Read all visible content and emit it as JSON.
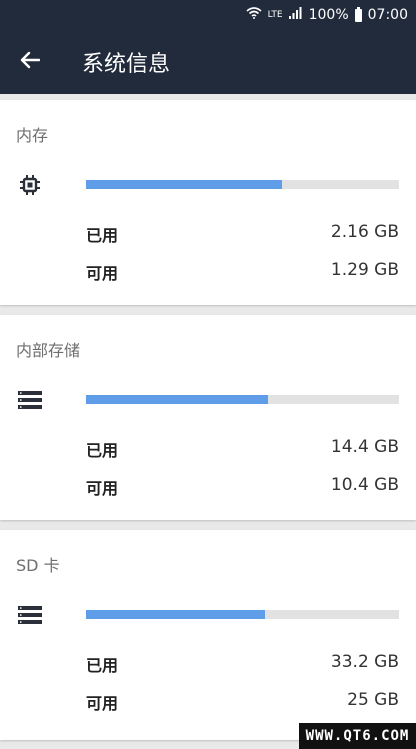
{
  "status_bar": {
    "network": "LTE",
    "battery": "100%",
    "time": "07:00",
    "icons": [
      "wifi-icon",
      "signal-icon",
      "battery-icon"
    ]
  },
  "app_bar": {
    "back_icon": "arrow-left-icon",
    "title": "系统信息"
  },
  "colors": {
    "app_bar": "#222b3c",
    "bar_fill": "#5f9de8",
    "bar_track": "#e2e2e2",
    "background": "#e9e9e9"
  },
  "sections": [
    {
      "title": "内存",
      "icon": "chip-icon",
      "used_fraction": 0.626,
      "used_label": "已用",
      "used_value": "2.16 GB",
      "free_label": "可用",
      "free_value": "1.29 GB"
    },
    {
      "title": "内部存储",
      "icon": "storage-icon",
      "used_fraction": 0.581,
      "used_label": "已用",
      "used_value": "14.4 GB",
      "free_label": "可用",
      "free_value": "10.4 GB"
    },
    {
      "title": "SD 卡",
      "icon": "storage-icon",
      "used_fraction": 0.571,
      "used_label": "已用",
      "used_value": "33.2 GB",
      "free_label": "可用",
      "free_value": "25 GB"
    }
  ],
  "watermark": "WWW.QT6.COM"
}
